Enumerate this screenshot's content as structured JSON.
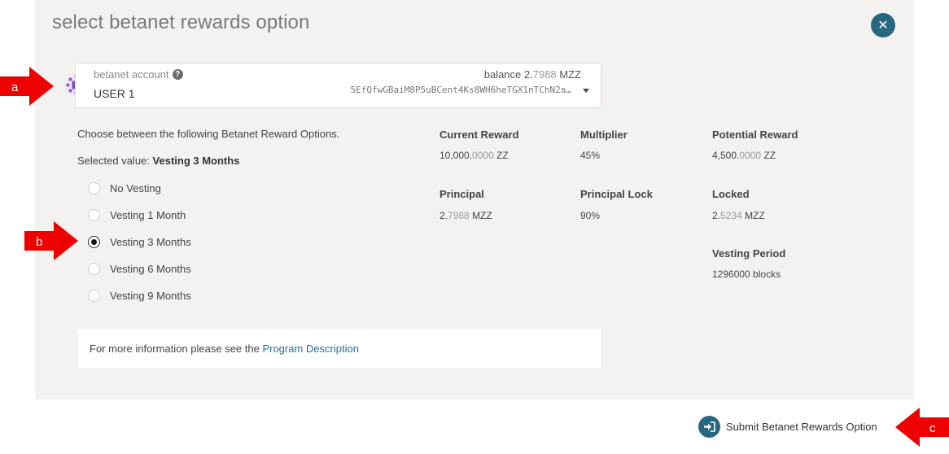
{
  "modal": {
    "title": "select betanet rewards option",
    "close_glyph": "✕"
  },
  "account": {
    "label": "betanet account",
    "help_glyph": "?",
    "name": "USER 1",
    "balance_label": "balance",
    "balance_int": "2.",
    "balance_frac": "7988",
    "balance_unit": "MZZ",
    "address": "5EfQfwGBaiM8P5uBCent4Ks8WH6heTGX1nTChN2a…"
  },
  "options": {
    "intro": "Choose between the following Betanet Reward Options.",
    "selected_prefix": "Selected value:",
    "selected_value": "Vesting 3 Months",
    "items": [
      {
        "label": "No Vesting",
        "checked": false
      },
      {
        "label": "Vesting 1 Month",
        "checked": false
      },
      {
        "label": "Vesting 3 Months",
        "checked": true
      },
      {
        "label": "Vesting 6 Months",
        "checked": false
      },
      {
        "label": "Vesting 9 Months",
        "checked": false
      }
    ]
  },
  "stats": {
    "current_reward": {
      "label": "Current Reward",
      "int": "10,000.",
      "frac": "0000",
      "unit": "ZZ"
    },
    "multiplier": {
      "label": "Multiplier",
      "value": "45%"
    },
    "potential_reward": {
      "label": "Potential Reward",
      "int": "4,500.",
      "frac": "0000",
      "unit": "ZZ"
    },
    "principal": {
      "label": "Principal",
      "int": "2.",
      "frac": "7988",
      "unit": "MZZ"
    },
    "principal_lock": {
      "label": "Principal Lock",
      "value": "90%"
    },
    "locked": {
      "label": "Locked",
      "int": "2.",
      "frac": "5234",
      "unit": "MZZ"
    },
    "vesting_period": {
      "label": "Vesting Period",
      "value": "1296000 blocks"
    }
  },
  "info": {
    "text": "For more information please see the",
    "link": "Program Description"
  },
  "submit": {
    "label": "Submit Betanet Rewards Option"
  },
  "markers": {
    "a": "a",
    "b": "b",
    "c": "c"
  },
  "colors": {
    "accent": "#276880",
    "marker": "#ee0000",
    "modal_bg": "#f3f2f1",
    "link": "#2a6f9a"
  }
}
